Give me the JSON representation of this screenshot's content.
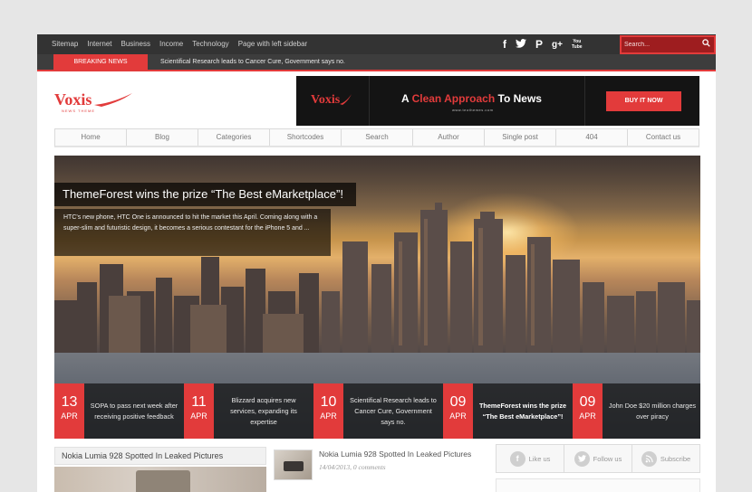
{
  "topbar": {
    "nav": [
      "Sitemap",
      "Internet",
      "Business",
      "Income",
      "Technology",
      "Page with left sidebar"
    ],
    "social_icons": [
      "facebook-icon",
      "twitter-icon",
      "pinterest-icon",
      "google-plus-icon",
      "youtube-icon"
    ],
    "social_glyphs": {
      "facebook": "f",
      "twitter": "t",
      "pinterest": "P",
      "gplus": "g+",
      "youtube_1": "You",
      "youtube_2": "Tube"
    },
    "search_placeholder": "Search...",
    "search_icon": "⌕"
  },
  "breaking": {
    "label": "BREAKING NEWS",
    "text": "Scientifical Research leads to Cancer Cure, Government says no."
  },
  "logo": {
    "name": "Voxis",
    "sub": "NEWS THEME"
  },
  "ad": {
    "logo": "Voxis",
    "headline_1": "A",
    "headline_2": "Clean Approach",
    "headline_3": "To News",
    "url": "www.teothemes.com",
    "button": "BUY IT NOW"
  },
  "mainnav": [
    "Home",
    "Blog",
    "Categories",
    "Shortcodes",
    "Search",
    "Author",
    "Single post",
    "404",
    "Contact us"
  ],
  "hero": {
    "title": "ThemeForest wins the prize “The Best eMarketplace”!",
    "desc": "HTC's new phone, HTC One is announced to hit the market this April. Coming along with a super-slim and futuristic design, it becomes a serious contestant for the iPhone 5 and ..."
  },
  "strip": [
    {
      "day": "13",
      "mon": "APR",
      "title": "SOPA to pass next week after receiving positive feedback"
    },
    {
      "day": "11",
      "mon": "APR",
      "title": "Blizzard acquires new services, expanding its expertise"
    },
    {
      "day": "10",
      "mon": "APR",
      "title": "Scientifical Research leads to Cancer Cure, Government says no."
    },
    {
      "day": "09",
      "mon": "APR",
      "title": "ThemeForest wins the prize “The Best eMarketplace”!"
    },
    {
      "day": "09",
      "mon": "APR",
      "title": "John Doe $20 million charges over piracy"
    }
  ],
  "bottom_left": {
    "title": "Nokia Lumia 928 Spotted In Leaked Pictures"
  },
  "bottom_mid": {
    "title": "Nokia Lumia 928 Spotted In Leaked Pictures",
    "meta": "14/04/2013, 0 comments"
  },
  "bottom_right": [
    {
      "icon": "f",
      "label": "Like us"
    },
    {
      "icon": "t",
      "label": "Follow us"
    },
    {
      "icon": "rss",
      "label": "Subscribe"
    }
  ],
  "colors": {
    "accent": "#e23b3b",
    "topbar": "#333333",
    "dark": "#141414"
  }
}
